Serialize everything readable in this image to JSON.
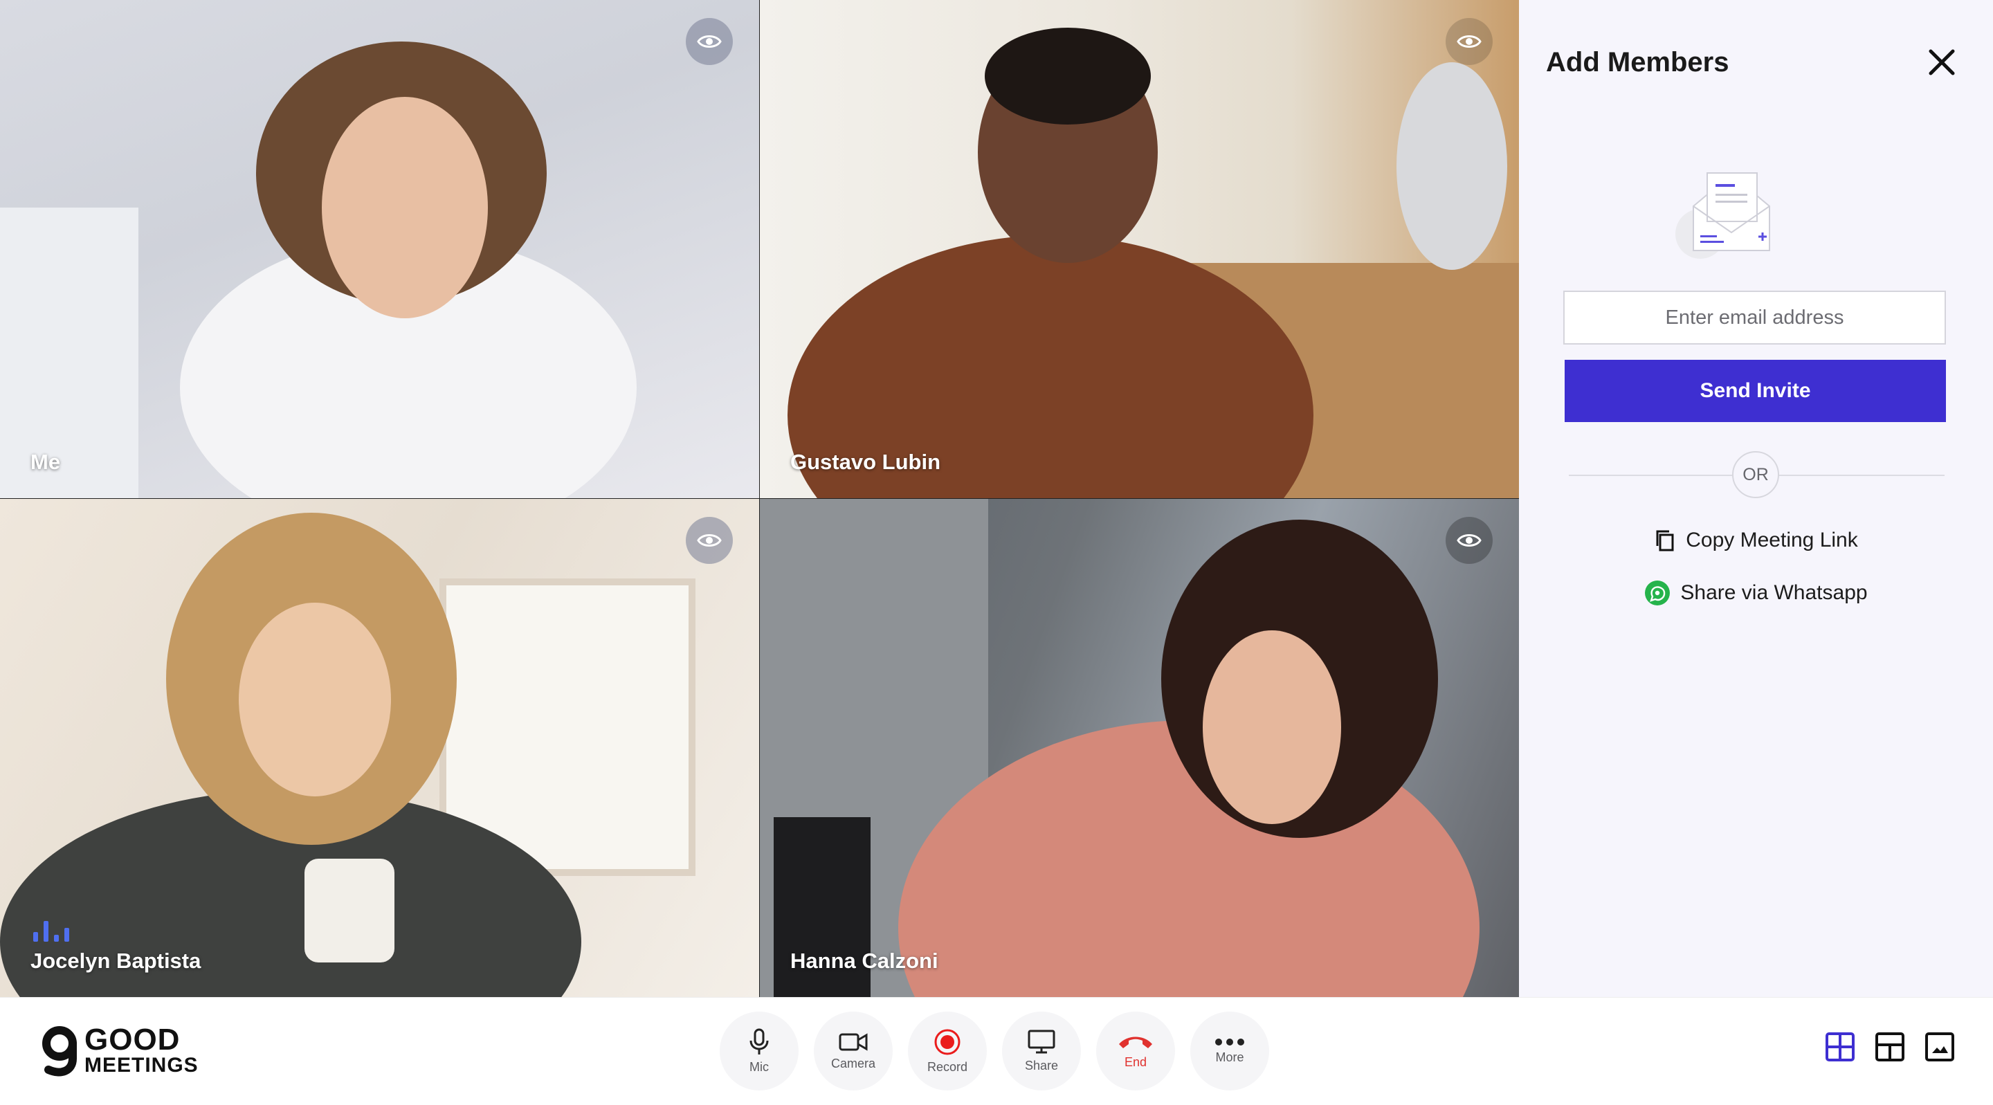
{
  "tiles": [
    {
      "name": "Me"
    },
    {
      "name": "Gustavo Lubin"
    },
    {
      "name": "Jocelyn Baptista"
    },
    {
      "name": "Hanna Calzoni"
    }
  ],
  "panel": {
    "title": "Add Members",
    "email_placeholder": "Enter email address",
    "send_label": "Send Invite",
    "or_label": "OR",
    "copy_link_label": "Copy Meeting Link",
    "whatsapp_label": "Share via Whatsapp"
  },
  "brand": {
    "line1": "GOOD",
    "line2": "MEETINGS"
  },
  "controls": {
    "mic": "Mic",
    "camera": "Camera",
    "record": "Record",
    "share": "Share",
    "end": "End",
    "more": "More"
  },
  "colors": {
    "accent": "#3e2fd1",
    "end_red": "#e0322f",
    "record_red": "#ea1c1c",
    "whatsapp_green": "#25b34b",
    "panel_bg": "#f6f5fc"
  }
}
